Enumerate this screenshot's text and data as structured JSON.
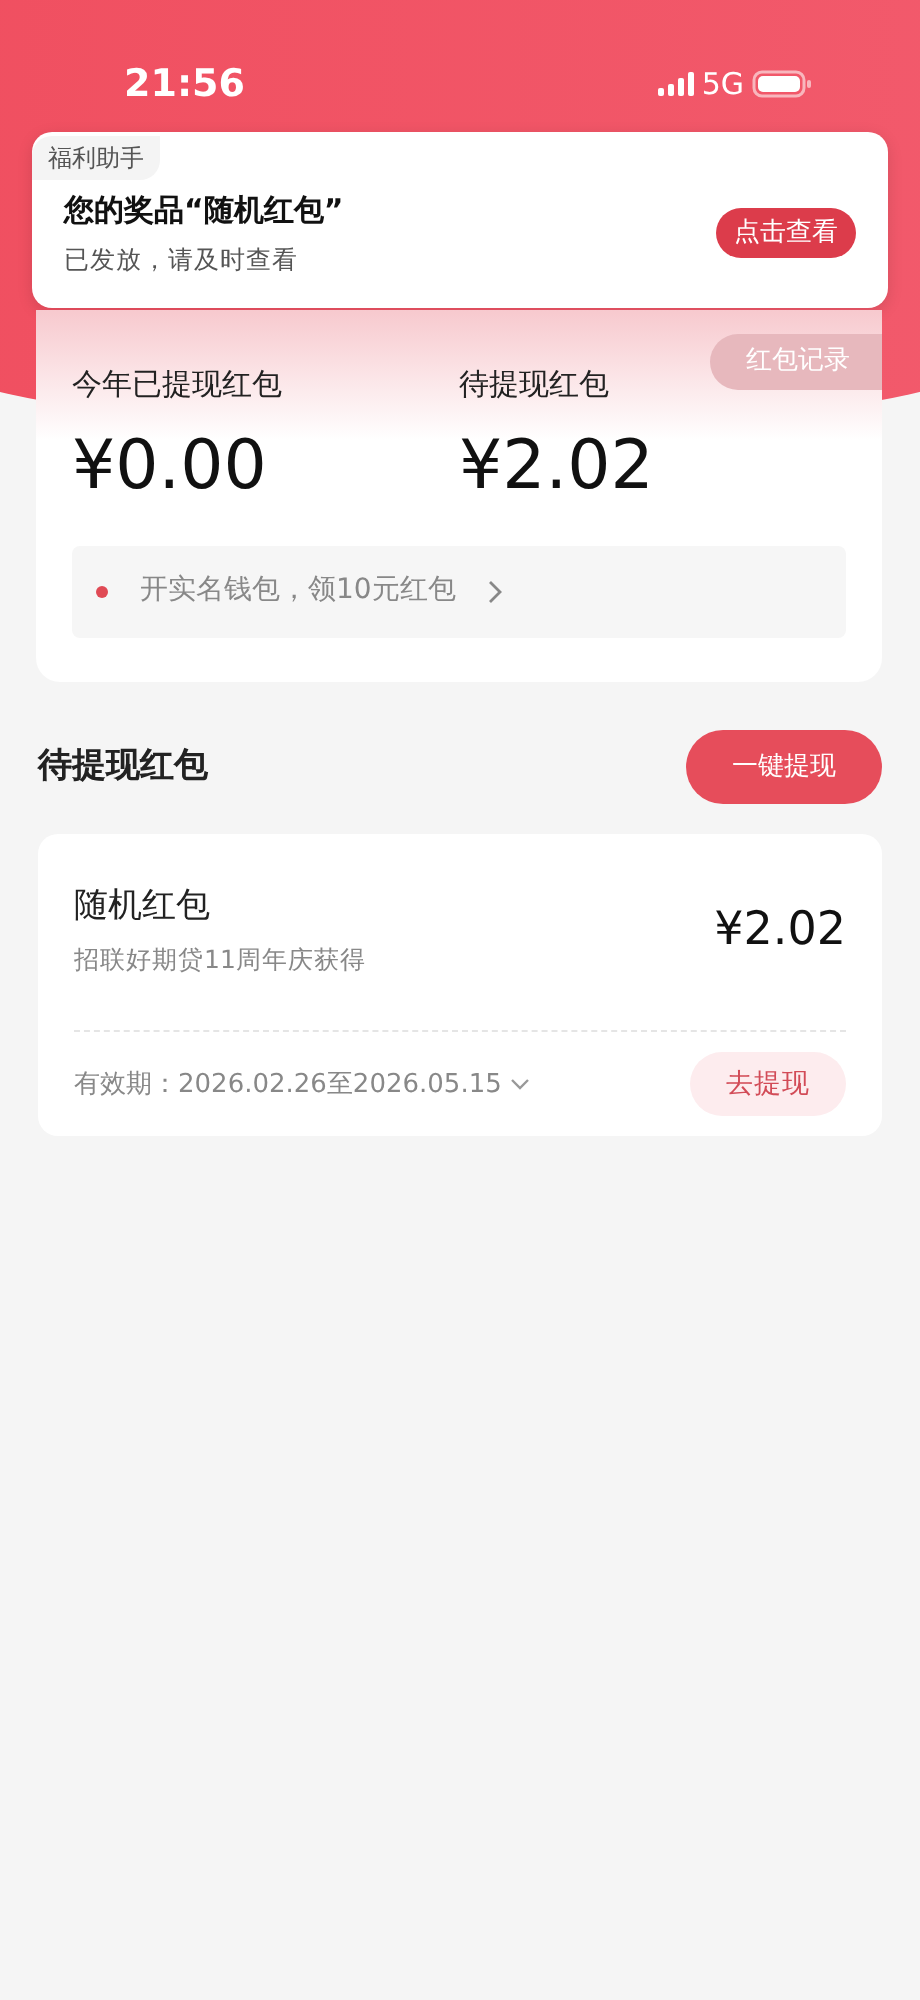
{
  "status_bar": {
    "time": "21:56",
    "network": "5G"
  },
  "notification": {
    "app": "福利助手",
    "title": "您的奖品“随机红包”",
    "subtitle": "已发放，请及时查看",
    "button": "点击查看"
  },
  "summary": {
    "records_button": "红包记录",
    "stats": [
      {
        "label": "今年已提现红包",
        "amount": "¥0.00"
      },
      {
        "label": "待提现红包",
        "amount": "¥2.02"
      }
    ],
    "promo": "开实名钱包，领10元红包"
  },
  "section": {
    "title": "待提现红包",
    "button": "一键提现"
  },
  "coupons": [
    {
      "name": "随机红包",
      "source": "招联好期贷11周年庆获得",
      "amount": "¥2.02",
      "validity": "有效期：2026.02.26至2026.05.15",
      "button": "去提现"
    }
  ]
}
